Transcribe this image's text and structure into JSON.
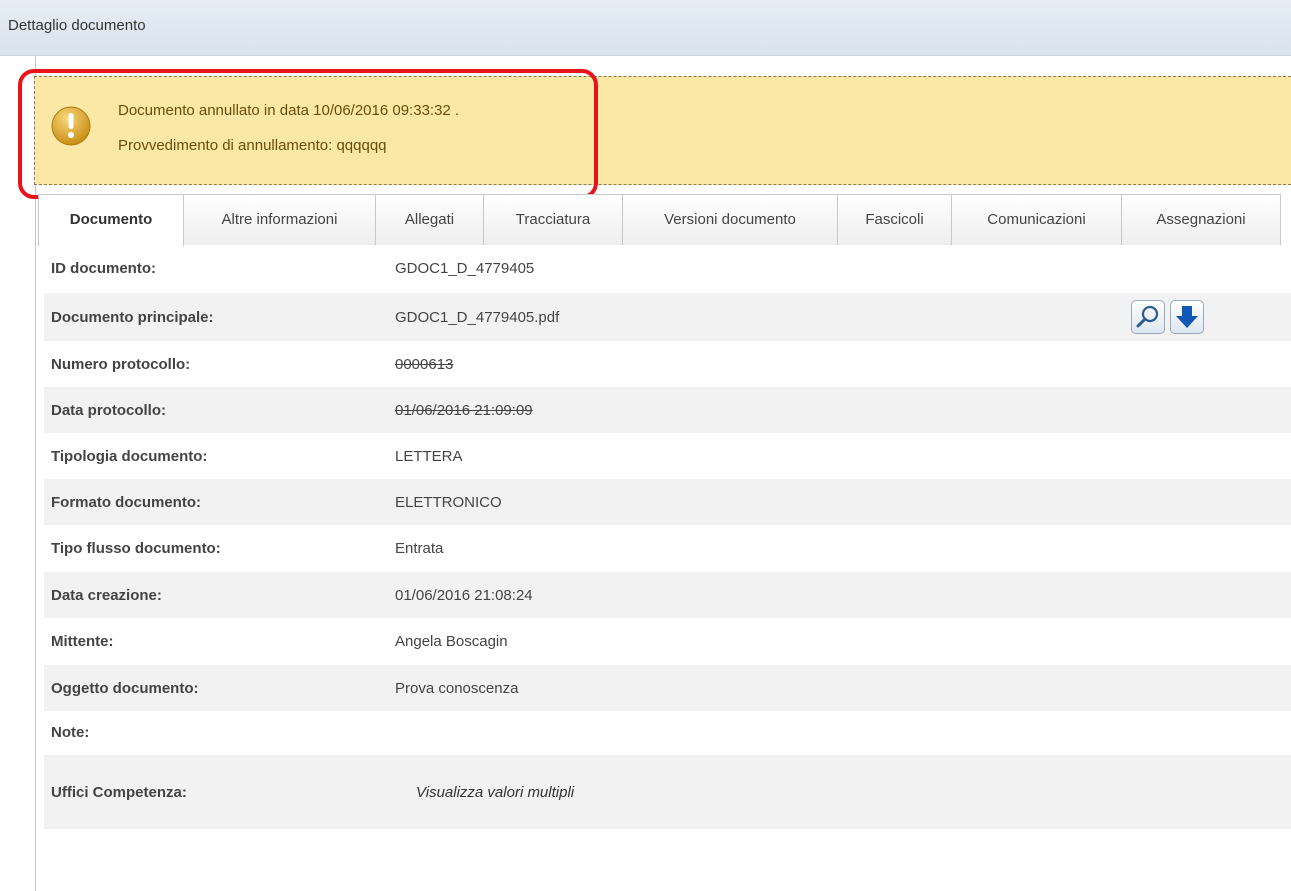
{
  "window": {
    "title": "Dettaglio documento"
  },
  "warning": {
    "line1": "Documento annullato in data 10/06/2016 09:33:32 .",
    "line2": "Provvedimento di annullamento: qqqqqq",
    "icon": "warning-icon",
    "color": "#fbe7a6",
    "highlight_color": "#e8141b"
  },
  "tabs": [
    {
      "label": "Documento",
      "active": true
    },
    {
      "label": "Altre informazioni"
    },
    {
      "label": "Allegati"
    },
    {
      "label": "Tracciatura"
    },
    {
      "label": "Versioni documento"
    },
    {
      "label": "Fascicoli"
    },
    {
      "label": "Comunicazioni"
    },
    {
      "label": "Assegnazioni"
    }
  ],
  "fields": [
    {
      "label": "ID documento:",
      "value": "GDOC1_D_4779405"
    },
    {
      "label": "Documento principale:",
      "value": "GDOC1_D_4779405.pdf",
      "actions": [
        "search-icon",
        "download-arrow-icon"
      ]
    },
    {
      "label": "Numero protocollo:",
      "value": "0000613",
      "struck": true
    },
    {
      "label": "Data protocollo:",
      "value": "01/06/2016 21:09:09",
      "struck": true
    },
    {
      "label": "Tipologia documento:",
      "value": "LETTERA"
    },
    {
      "label": "Formato documento:",
      "value": "ELETTRONICO"
    },
    {
      "label": "Tipo flusso documento:",
      "value": "Entrata"
    },
    {
      "label": "Data creazione:",
      "value": "01/06/2016 21:08:24"
    },
    {
      "label": "Mittente:",
      "value": "Angela Boscagin"
    },
    {
      "label": "Oggetto documento:",
      "value": "Prova conoscenza"
    },
    {
      "label": "Note:",
      "value": ""
    },
    {
      "label": "Uffici Competenza:",
      "value": "Visualizza valori multipli",
      "italic": true
    }
  ]
}
